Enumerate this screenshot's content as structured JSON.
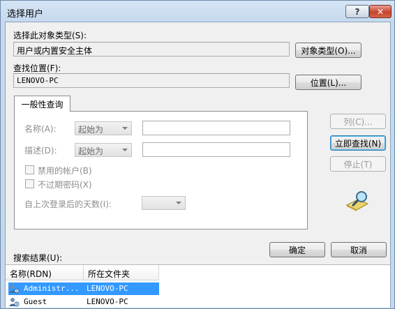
{
  "window": {
    "title": "选择用户",
    "help_label": "?",
    "close_label": "✕"
  },
  "object_type": {
    "label": "选择此对象类型(S):",
    "value": "用户或内置安全主体",
    "button": "对象类型(O)..."
  },
  "location": {
    "label": "查找位置(F):",
    "value": "LENOVO-PC",
    "button": "位置(L)..."
  },
  "query": {
    "tab_label": "一般性查询",
    "name_label": "名称(A):",
    "name_combo": "起始为",
    "desc_label": "描述(D):",
    "desc_combo": "起始为",
    "disabled_accounts": "禁用的帐户(B)",
    "no_expire_password": "不过期密码(X)",
    "days_since_logon": "自上次登录后的天数(I):"
  },
  "side_buttons": {
    "columns": "列(C)...",
    "find_now": "立即查找(N)",
    "stop": "停止(T)"
  },
  "icons": {
    "search_graphic": "magnifier-icon",
    "user": "user-icon"
  },
  "results": {
    "label": "搜索结果(U):",
    "columns": [
      "名称(RDN)",
      "所在文件夹"
    ],
    "rows": [
      {
        "name": "Administr...",
        "folder": "LENOVO-PC",
        "selected": true
      },
      {
        "name": "Guest",
        "folder": "LENOVO-PC",
        "selected": false
      }
    ]
  },
  "dialog_buttons": {
    "ok": "确定",
    "cancel": "取消"
  },
  "colors": {
    "selection": "#3399ff",
    "close_button": "#c7432c"
  }
}
